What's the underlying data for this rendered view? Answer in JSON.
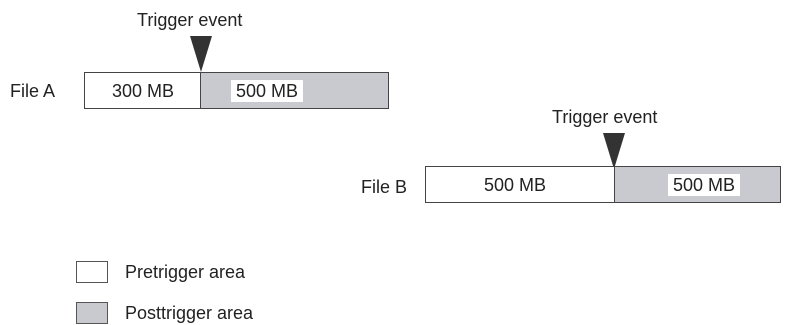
{
  "colors": {
    "pretrigger": "#ffffff",
    "posttrigger": "#c8cacf",
    "outline": "#444444",
    "marker": "#333333"
  },
  "file_a": {
    "name": "File A",
    "trigger_label": "Trigger event",
    "pretrigger_size": "300 MB",
    "posttrigger_size": "500 MB"
  },
  "file_b": {
    "name": "File B",
    "trigger_label": "Trigger event",
    "pretrigger_size": "500 MB",
    "posttrigger_size": "500 MB"
  },
  "legend": {
    "pretrigger_label": "Pretrigger area",
    "posttrigger_label": "Posttrigger area"
  }
}
